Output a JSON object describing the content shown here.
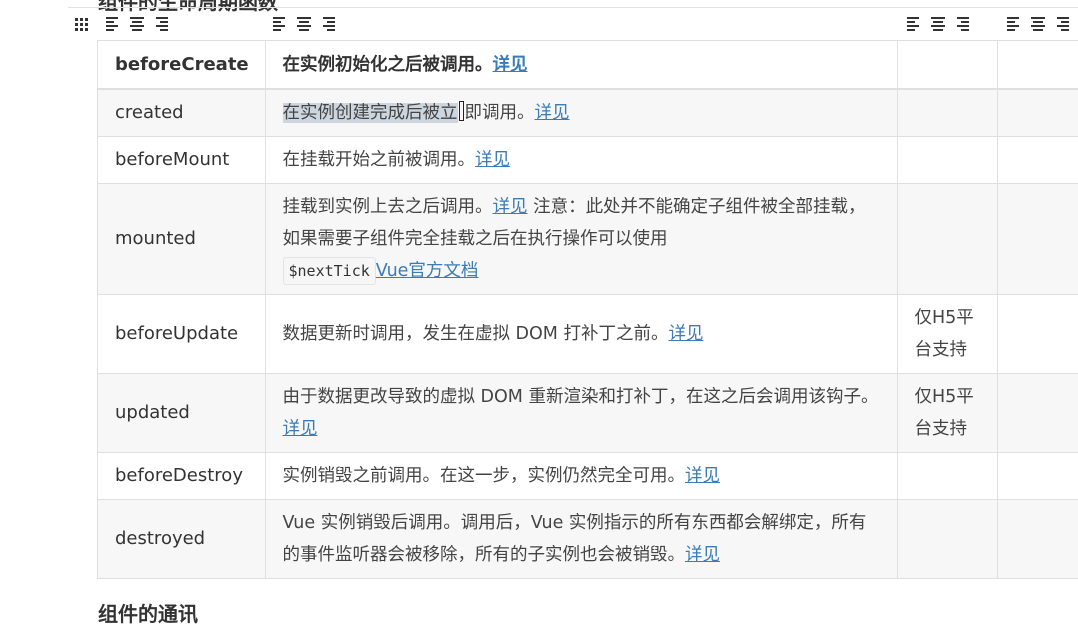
{
  "page": {
    "heading_partial": "组件的生命周期函数",
    "footer_partial": "组件的通讯"
  },
  "toolbar": {
    "grid_icon": "grid-icon",
    "align_icons": [
      "align-left-icon",
      "align-center-icon",
      "align-right-icon"
    ]
  },
  "links": {
    "detail": "详见",
    "vue_docs": "Vue官方文档"
  },
  "code": {
    "nexttick": "$nextTick"
  },
  "rows": [
    {
      "name": "beforeCreate",
      "desc": "在实例初始化之后被调用。",
      "note": ""
    },
    {
      "name": "created",
      "desc_selected": "在实例创建完成后被立",
      "desc_rest": "即调用。",
      "note": ""
    },
    {
      "name": "beforeMount",
      "desc": "在挂载开始之前被调用。",
      "note": ""
    },
    {
      "name": "mounted",
      "desc": "挂载到实例上去之后调用。",
      "desc_after_link": " 注意：此处并不能确定子组件被全部挂载，如果需要子组件完全挂载之后在执行操作可以使用",
      "note": ""
    },
    {
      "name": "beforeUpdate",
      "desc": "数据更新时调用，发生在虚拟 DOM 打补丁之前。",
      "note": "仅H5平台支持"
    },
    {
      "name": "updated",
      "desc": "由于数据更改导致的虚拟 DOM 重新渲染和打补丁，在这之后会调用该钩子。",
      "note": "仅H5平台支持"
    },
    {
      "name": "beforeDestroy",
      "desc": "实例销毁之前调用。在这一步，实例仍然完全可用。",
      "note": ""
    },
    {
      "name": "destroyed",
      "desc": "Vue 实例销毁后调用。调用后，Vue 实例指示的所有东西都会解绑定，所有的事件监听器会被移除，所有的子实例也会被销毁。",
      "note": ""
    }
  ]
}
